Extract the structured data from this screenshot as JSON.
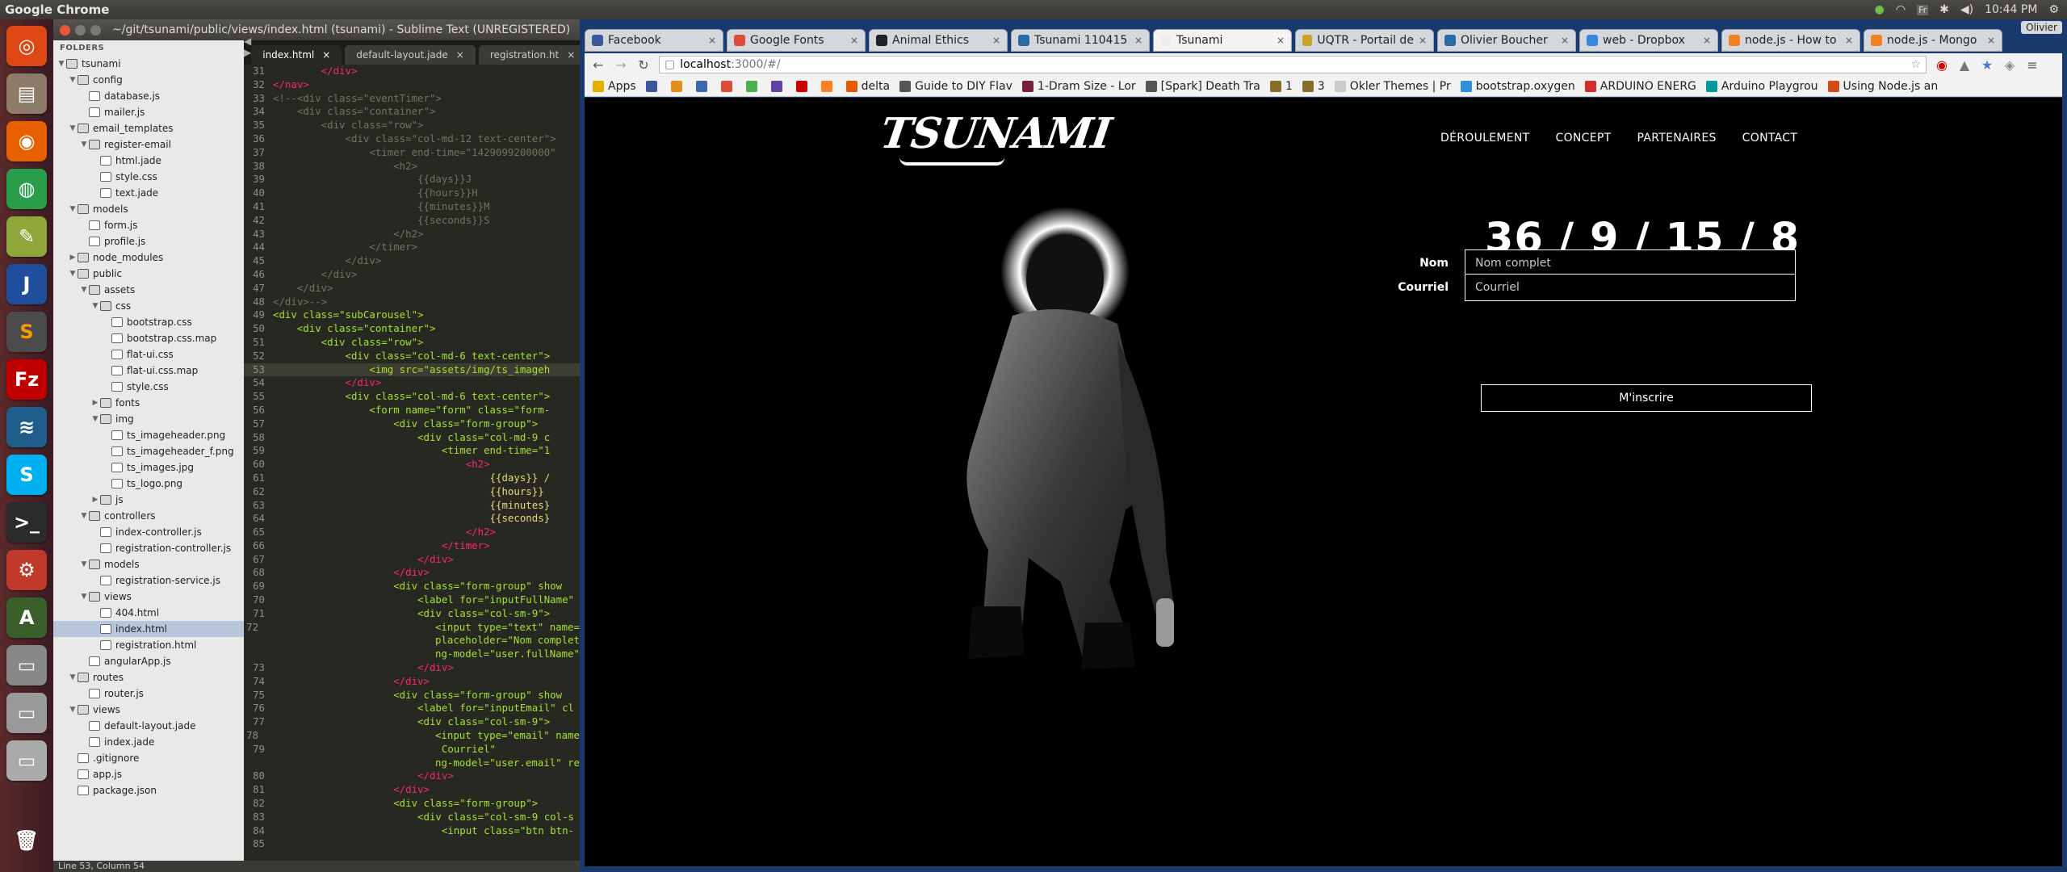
{
  "topbar": {
    "app": "Google Chrome",
    "time": "10:44 PM",
    "keyboard": "Fr"
  },
  "launcher": {
    "items": [
      "ubuntu-logo",
      "files",
      "firefox",
      "chrome",
      "gimp",
      "intellij",
      "sublime",
      "filezilla",
      "mysql",
      "skype",
      "terminal",
      "settings",
      "updates",
      "disks",
      "drive",
      "drive2",
      "trash"
    ]
  },
  "sublime": {
    "title": "~/git/tsunami/public/views/index.html (tsunami) - Sublime Text (UNREGISTERED)",
    "folders_label": "FOLDERS",
    "status": "Line 53, Column 54",
    "tabs": [
      {
        "label": "index.html",
        "active": true
      },
      {
        "label": "default-layout.jade",
        "active": false
      },
      {
        "label": "registration.ht",
        "active": false
      }
    ],
    "tree": [
      {
        "d": 0,
        "t": "tsunami",
        "f": true,
        "o": true
      },
      {
        "d": 1,
        "t": "config",
        "f": true,
        "o": true
      },
      {
        "d": 2,
        "t": "database.js"
      },
      {
        "d": 2,
        "t": "mailer.js"
      },
      {
        "d": 1,
        "t": "email_templates",
        "f": true,
        "o": true
      },
      {
        "d": 2,
        "t": "register-email",
        "f": true,
        "o": true
      },
      {
        "d": 3,
        "t": "html.jade"
      },
      {
        "d": 3,
        "t": "style.css"
      },
      {
        "d": 3,
        "t": "text.jade"
      },
      {
        "d": 1,
        "t": "models",
        "f": true,
        "o": true
      },
      {
        "d": 2,
        "t": "form.js"
      },
      {
        "d": 2,
        "t": "profile.js"
      },
      {
        "d": 1,
        "t": "node_modules",
        "f": true,
        "o": false
      },
      {
        "d": 1,
        "t": "public",
        "f": true,
        "o": true
      },
      {
        "d": 2,
        "t": "assets",
        "f": true,
        "o": true
      },
      {
        "d": 3,
        "t": "css",
        "f": true,
        "o": true
      },
      {
        "d": 4,
        "t": "bootstrap.css"
      },
      {
        "d": 4,
        "t": "bootstrap.css.map"
      },
      {
        "d": 4,
        "t": "flat-ui.css"
      },
      {
        "d": 4,
        "t": "flat-ui.css.map"
      },
      {
        "d": 4,
        "t": "style.css"
      },
      {
        "d": 3,
        "t": "fonts",
        "f": true,
        "o": false
      },
      {
        "d": 3,
        "t": "img",
        "f": true,
        "o": true
      },
      {
        "d": 4,
        "t": "ts_imageheader.png"
      },
      {
        "d": 4,
        "t": "ts_imageheader_f.png"
      },
      {
        "d": 4,
        "t": "ts_images.jpg"
      },
      {
        "d": 4,
        "t": "ts_logo.png"
      },
      {
        "d": 3,
        "t": "js",
        "f": true,
        "o": false
      },
      {
        "d": 2,
        "t": "controllers",
        "f": true,
        "o": true
      },
      {
        "d": 3,
        "t": "index-controller.js"
      },
      {
        "d": 3,
        "t": "registration-controller.js"
      },
      {
        "d": 2,
        "t": "models",
        "f": true,
        "o": true
      },
      {
        "d": 3,
        "t": "registration-service.js"
      },
      {
        "d": 2,
        "t": "views",
        "f": true,
        "o": true
      },
      {
        "d": 3,
        "t": "404.html"
      },
      {
        "d": 3,
        "t": "index.html",
        "sel": true
      },
      {
        "d": 3,
        "t": "registration.html"
      },
      {
        "d": 2,
        "t": "angularApp.js"
      },
      {
        "d": 1,
        "t": "routes",
        "f": true,
        "o": true
      },
      {
        "d": 2,
        "t": "router.js"
      },
      {
        "d": 1,
        "t": "views",
        "f": true,
        "o": true
      },
      {
        "d": 2,
        "t": "default-layout.jade"
      },
      {
        "d": 2,
        "t": "index.jade"
      },
      {
        "d": 1,
        "t": ".gitignore"
      },
      {
        "d": 1,
        "t": "app.js"
      },
      {
        "d": 1,
        "t": "package.json"
      }
    ],
    "code": [
      {
        "n": "31",
        "s": "        </div>",
        "k": "tag"
      },
      {
        "n": "32",
        "s": "</nav>",
        "k": "tag"
      },
      {
        "n": "33",
        "s": "<!--<div class=\"eventTimer\">",
        "k": "com"
      },
      {
        "n": "34",
        "s": "    <div class=\"container\">",
        "k": "com"
      },
      {
        "n": "35",
        "s": "        <div class=\"row\">",
        "k": "com"
      },
      {
        "n": "36",
        "s": "            <div class=\"col-md-12 text-center\">",
        "k": "com"
      },
      {
        "n": "37",
        "s": "                <timer end-time=\"1429099200000\"",
        "k": "com"
      },
      {
        "n": "38",
        "s": "                    <h2>",
        "k": "com"
      },
      {
        "n": "39",
        "s": "                        {{days}}J",
        "k": "com"
      },
      {
        "n": "40",
        "s": "                        {{hours}}H",
        "k": "com"
      },
      {
        "n": "41",
        "s": "                        {{minutes}}M",
        "k": "com"
      },
      {
        "n": "42",
        "s": "                        {{seconds}}S",
        "k": "com"
      },
      {
        "n": "43",
        "s": "                    </h2>",
        "k": "com"
      },
      {
        "n": "44",
        "s": "                </timer>",
        "k": "com"
      },
      {
        "n": "45",
        "s": "            </div>",
        "k": "com"
      },
      {
        "n": "46",
        "s": "        </div>",
        "k": "com"
      },
      {
        "n": "47",
        "s": "    </div>",
        "k": "com"
      },
      {
        "n": "48",
        "s": "</div>-->",
        "k": "com"
      },
      {
        "n": "49",
        "s": "<div class=\"subCarousel\">",
        "k": "tag"
      },
      {
        "n": "50",
        "s": "    <div class=\"container\">",
        "k": "tag"
      },
      {
        "n": "51",
        "s": "        <div class=\"row\">",
        "k": "tag"
      },
      {
        "n": "52",
        "s": "            <div class=\"col-md-6 text-center\">",
        "k": "tag"
      },
      {
        "n": "53",
        "s": "                <img src=\"assets/img/ts_imageh",
        "k": "tag",
        "cur": true
      },
      {
        "n": "54",
        "s": "            </div>",
        "k": "tag"
      },
      {
        "n": "55",
        "s": "            <div class=\"col-md-6 text-center\">",
        "k": "tag"
      },
      {
        "n": "56",
        "s": "                <form name=\"form\" class=\"form-",
        "k": "tag"
      },
      {
        "n": "57",
        "s": "                    <div class=\"form-group\">",
        "k": "tag"
      },
      {
        "n": "58",
        "s": "                        <div class=\"col-md-9 c",
        "k": "tag"
      },
      {
        "n": "59",
        "s": "                            <timer end-time=\"1",
        "k": "tag"
      },
      {
        "n": "60",
        "s": "                                <h2>",
        "k": "tag"
      },
      {
        "n": "61",
        "s": "                                    {{days}} /",
        "k": "txt"
      },
      {
        "n": "62",
        "s": "                                    {{hours}}",
        "k": "txt"
      },
      {
        "n": "63",
        "s": "                                    {{minutes}",
        "k": "txt"
      },
      {
        "n": "64",
        "s": "                                    {{seconds}",
        "k": "txt"
      },
      {
        "n": "65",
        "s": "                                </h2>",
        "k": "tag"
      },
      {
        "n": "66",
        "s": "                            </timer>",
        "k": "tag"
      },
      {
        "n": "67",
        "s": "                        </div>",
        "k": "tag"
      },
      {
        "n": "68",
        "s": "                    </div>",
        "k": "tag"
      },
      {
        "n": "69",
        "s": "                    <div class=\"form-group\" show",
        "k": "tag"
      },
      {
        "n": "70",
        "s": "                        <label for=\"inputFullName\"",
        "k": "tag"
      },
      {
        "n": "71",
        "s": "                        <div class=\"col-sm-9\">",
        "k": "tag"
      },
      {
        "n": "72",
        "s": "                            <input type=\"text\" name=",
        "k": "tag"
      },
      {
        "n": "",
        "s": "                            placeholder=\"Nom complet",
        "k": "tag"
      },
      {
        "n": "",
        "s": "                            ng-model=\"user.fullName\"",
        "k": "tag"
      },
      {
        "n": "73",
        "s": "                        </div>",
        "k": "tag"
      },
      {
        "n": "74",
        "s": "                    </div>",
        "k": "tag"
      },
      {
        "n": "75",
        "s": "                    <div class=\"form-group\" show",
        "k": "tag"
      },
      {
        "n": "76",
        "s": "                        <label for=\"inputEmail\" cl",
        "k": "tag"
      },
      {
        "n": "77",
        "s": "                        <div class=\"col-sm-9\">",
        "k": "tag"
      },
      {
        "n": "78",
        "s": "                            <input type=\"email\" name",
        "k": "tag"
      },
      {
        "n": "79",
        "s": "                            Courriel\"",
        "k": "tag"
      },
      {
        "n": "",
        "s": "                            ng-model=\"user.email\" re",
        "k": "tag"
      },
      {
        "n": "80",
        "s": "                        </div>",
        "k": "tag"
      },
      {
        "n": "81",
        "s": "                    </div>",
        "k": "tag"
      },
      {
        "n": "82",
        "s": "                    <div class=\"form-group\">",
        "k": "tag"
      },
      {
        "n": "83",
        "s": "                        <div class=\"col-sm-9 col-s",
        "k": "tag"
      },
      {
        "n": "84",
        "s": "                            <input class=\"btn btn-",
        "k": "tag"
      },
      {
        "n": "85",
        "s": "",
        "k": "tag"
      }
    ]
  },
  "chrome": {
    "profile": "Olivier",
    "tabs": [
      {
        "label": "Facebook",
        "color": "#3b5998"
      },
      {
        "label": "Google Fonts",
        "color": "#dd4b39"
      },
      {
        "label": "Animal Ethics",
        "color": "#222222"
      },
      {
        "label": "Tsunami 110415",
        "color": "#2a6aa8"
      },
      {
        "label": "Tsunami",
        "color": "#eeeeee",
        "active": true
      },
      {
        "label": "UQTR - Portail de",
        "color": "#c9a227"
      },
      {
        "label": "Olivier Boucher",
        "color": "#2a6aa8"
      },
      {
        "label": "web - Dropbox",
        "color": "#3a87e0"
      },
      {
        "label": "node.js - How to",
        "color": "#f48024"
      },
      {
        "label": "node.js - Mongo",
        "color": "#f48024"
      }
    ],
    "url_host": "localhost",
    "url_path": ":3000/#/",
    "bookmarks": [
      {
        "label": "Apps",
        "color": "#e0b000"
      },
      {
        "label": "",
        "color": "#3b5998"
      },
      {
        "label": "",
        "color": "#e09020"
      },
      {
        "label": "",
        "color": "#3d6ba8"
      },
      {
        "label": "",
        "color": "#dd4b39"
      },
      {
        "label": "",
        "color": "#4caf50"
      },
      {
        "label": "",
        "color": "#6441a5"
      },
      {
        "label": "",
        "color": "#cc0000"
      },
      {
        "label": "",
        "color": "#ff7f27"
      },
      {
        "label": "delta",
        "color": "#e55a00"
      },
      {
        "label": "Guide to DIY Flav",
        "color": "#555555"
      },
      {
        "label": "1-Dram Size - Lor",
        "color": "#7a1f3d"
      },
      {
        "label": "[Spark] Death Tra",
        "color": "#555555"
      },
      {
        "label": "1",
        "color": "#8a6b2a"
      },
      {
        "label": "3",
        "color": "#8a6b2a"
      },
      {
        "label": "Okler Themes | Pr",
        "color": "#cccccc"
      },
      {
        "label": "bootstrap.oxygen",
        "color": "#2d8fd5"
      },
      {
        "label": "ARDUINO ENERG",
        "color": "#d22e2e"
      },
      {
        "label": "Arduino Playgrou",
        "color": "#00979d"
      },
      {
        "label": "Using Node.js an",
        "color": "#d24b14"
      }
    ]
  },
  "site": {
    "logo": "TSUNAMI",
    "nav": [
      "DÉROULEMENT",
      "CONCEPT",
      "PARTENAIRES",
      "CONTACT"
    ],
    "timer": "36 / 9 / 15 / 8",
    "form": {
      "name_label": "Nom",
      "name_placeholder": "Nom complet",
      "email_label": "Courriel",
      "email_placeholder": "Courriel",
      "submit": "M'inscrire"
    }
  }
}
